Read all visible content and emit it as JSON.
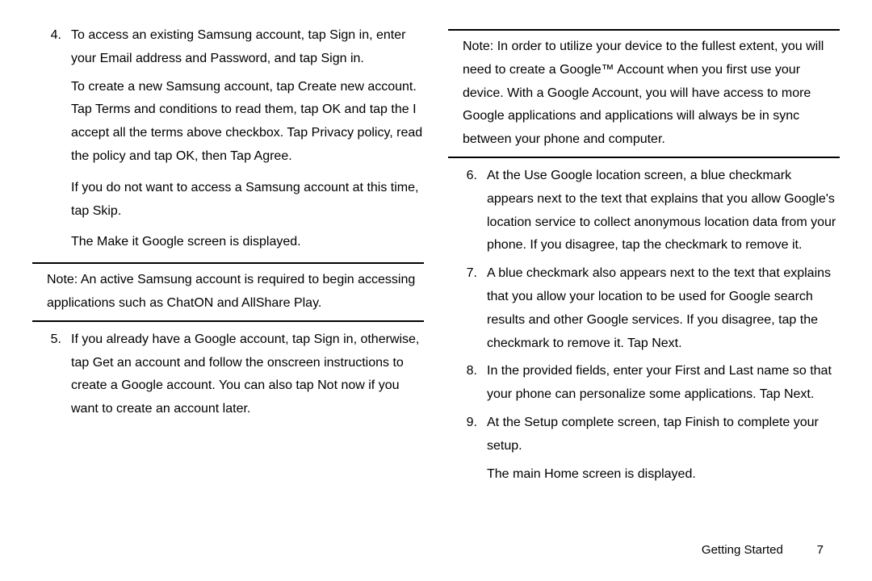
{
  "left": {
    "item4": {
      "num": "4.",
      "text": "To access an existing Samsung account, tap Sign in, enter your Email address and Password, and tap Sign in."
    },
    "para_create": "To create a new Samsung account, tap Create new account. Tap Terms and conditions to read them, tap OK and tap the I accept all the terms above checkbox. Tap Privacy policy, read the policy and tap OK, then Tap Agree.",
    "para_skip": "If you do not want to access a Samsung account at this time, tap Skip.",
    "para_make_google": "The Make it Google screen is displayed.",
    "note1_label": "Note:",
    "note1_body": " An active Samsung account is required to begin accessing applications such as ChatON and AllShare Play.",
    "item5": {
      "num": "5.",
      "text": "If you already have a Google account, tap Sign in, otherwise, tap Get an account and follow the onscreen instructions to create a Google account. You can also tap Not now if you want to create an account later."
    }
  },
  "right": {
    "note2_label": "Note:",
    "note2_body": " In order to utilize your device to the fullest extent, you will need to create a Google™ Account when you first use your device. With a Google Account, you will have access to more Google applications and applications will always be in sync between your phone and computer.",
    "item6": {
      "num": "6.",
      "text": "At the Use Google location screen, a blue checkmark appears next to the text that explains that you allow Google's location service to collect anonymous location data from your phone. If you disagree, tap the checkmark to remove it."
    },
    "item7": {
      "num": "7.",
      "text": "A blue checkmark also appears next to the text that explains that you allow your location to be used for Google search results and other Google services. If you disagree, tap the checkmark to remove it. Tap Next."
    },
    "item8": {
      "num": "8.",
      "text": "In the provided fields, enter your First and Last name so that your phone can personalize some applications. Tap Next."
    },
    "item9": {
      "num": "9.",
      "text": "At the Setup complete screen, tap Finish to complete your setup."
    },
    "para_home": "The main Home screen is displayed."
  },
  "footer": {
    "section": "Getting Started",
    "page": "7"
  }
}
